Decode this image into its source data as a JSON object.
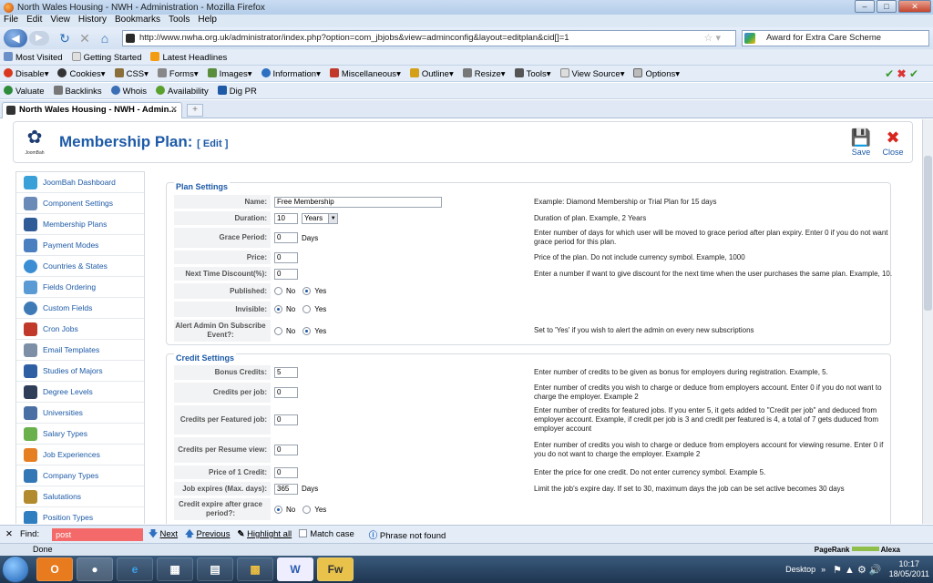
{
  "browser": {
    "title": "North Wales Housing - NWH - Administration - Mozilla Firefox",
    "menu": [
      "File",
      "Edit",
      "View",
      "History",
      "Bookmarks",
      "Tools",
      "Help"
    ],
    "url": "http://www.nwha.org.uk/administrator/index.php?option=com_jbjobs&view=adminconfig&layout=editplan&cid[]=1",
    "search_value": "Award for Extra Care Scheme",
    "bookmarks": [
      "Most Visited",
      "Getting Started",
      "Latest Headlines"
    ],
    "webdev_toolbar": [
      "Disable",
      "Cookies",
      "CSS",
      "Forms",
      "Images",
      "Information",
      "Miscellaneous",
      "Outline",
      "Resize",
      "Tools",
      "View Source",
      "Options"
    ],
    "seo_toolbar": [
      "Valuate",
      "Backlinks",
      "Whois",
      "Availability",
      "Dig PR"
    ],
    "tab_title": "North Wales Housing - NWH - Admin...",
    "find_label": "Find:",
    "find_value": "post",
    "find_next": "Next",
    "find_previous": "Previous",
    "highlight_all": "Highlight all",
    "match_case": "Match case",
    "find_status": "Phrase not found",
    "status": "Done",
    "pagerank": "PageRank",
    "alexa": "Alexa"
  },
  "page": {
    "logo_text": "JoomBah",
    "title": "Membership Plan:",
    "title_mode": "[ Edit ]",
    "save_label": "Save",
    "close_label": "Close"
  },
  "sidebar": [
    {
      "label": "JoomBah Dashboard",
      "color": "#3aa0d8"
    },
    {
      "label": "Component Settings",
      "color": "#6a8bb8"
    },
    {
      "label": "Membership Plans",
      "color": "#2f5c96"
    },
    {
      "label": "Payment Modes",
      "color": "#4a7fc0"
    },
    {
      "label": "Countries & States",
      "color": "#3b8ed4"
    },
    {
      "label": "Fields Ordering",
      "color": "#5b9bd5"
    },
    {
      "label": "Custom Fields",
      "color": "#3e7bb6"
    },
    {
      "label": "Cron Jobs",
      "color": "#c0392b"
    },
    {
      "label": "Email Templates",
      "color": "#7d8fa6"
    },
    {
      "label": "Studies of Majors",
      "color": "#2e5fa3"
    },
    {
      "label": "Degree Levels",
      "color": "#2f3e58"
    },
    {
      "label": "Universities",
      "color": "#4a6fa5"
    },
    {
      "label": "Salary Types",
      "color": "#6ab04c"
    },
    {
      "label": "Job Experiences",
      "color": "#e67e22"
    },
    {
      "label": "Company Types",
      "color": "#3477b7"
    },
    {
      "label": "Salutations",
      "color": "#b38b2f"
    },
    {
      "label": "Position Types",
      "color": "#2f7fc1"
    }
  ],
  "plan_settings": {
    "legend": "Plan Settings",
    "name_label": "Name:",
    "name_value": "Free Membership",
    "name_hint": "Example: Diamond Membership or Trial Plan for 15 days",
    "duration_label": "Duration:",
    "duration_value": "10",
    "duration_unit": "Years",
    "duration_hint": "Duration of plan. Example, 2 Years",
    "grace_label": "Grace Period:",
    "grace_value": "0",
    "grace_unit": "Days",
    "grace_hint": "Enter number of days for which user will be moved to grace period after plan expiry. Enter 0 if you do not want grace period for this plan.",
    "price_label": "Price:",
    "price_value": "0",
    "price_hint": "Price of the plan. Do not include currency symbol. Example, 1000",
    "discount_label": "Next Time Discount(%):",
    "discount_value": "0",
    "discount_hint": "Enter a number if want to give discount for the next time when the user purchases the same plan. Example, 10.",
    "published_label": "Published:",
    "invisible_label": "Invisible:",
    "alert_label": "Alert Admin On Subscribe Event?:",
    "alert_hint": "Set to 'Yes' if you wish to alert the admin on every new subscriptions",
    "no": "No",
    "yes": "Yes"
  },
  "credit_settings": {
    "legend": "Credit Settings",
    "bonus_label": "Bonus Credits:",
    "bonus_value": "5",
    "bonus_hint": "Enter number of credits to be given as bonus for employers during registration. Example, 5.",
    "perjob_label": "Credits per job:",
    "perjob_value": "0",
    "perjob_hint": "Enter number of credits you wish to charge or deduce from employers account. Enter 0 if you do not want to charge the employer. Example 2",
    "featured_label": "Credits per Featured job:",
    "featured_value": "0",
    "featured_hint": "Enter number of credits for featured jobs. If you enter 5, it gets added to \"Credit per job\" and deduced from employer account. Example, if credit per job is 3 and credit per featured is 4, a total of 7 gets duduced from employer account",
    "resume_label": "Credits per Resume view:",
    "resume_value": "0",
    "resume_hint": "Enter number of credits you wish to charge or deduce from employers account for viewing resume. Enter 0 if you do not want to charge the employer. Example 2",
    "price1_label": "Price of 1 Credit:",
    "price1_value": "0",
    "price1_hint": "Enter the price for one credit. Do not enter currency symbol. Example 5.",
    "expires_label": "Job expires (Max. days):",
    "expires_value": "365",
    "expires_unit": "Days",
    "expires_hint": "Limit the job's expire day. If set to 30, maximum days the job can be set active becomes 30 days",
    "credit_expire_label": "Credit expire after grace period?:",
    "no": "No",
    "yes": "Yes"
  },
  "taskbar": {
    "desktop": "Desktop",
    "time": "10:17",
    "date": "18/05/2011"
  }
}
